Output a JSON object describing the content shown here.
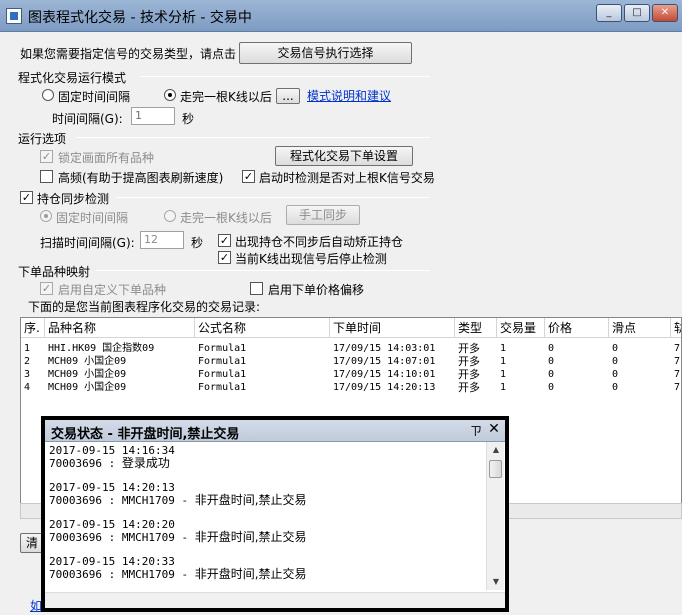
{
  "window": {
    "title": "图表程式化交易 - 技术分析 - 交易中",
    "minimize": "_",
    "maximize": "□",
    "close": "✕"
  },
  "signal": {
    "prompt": "如果您需要指定信号的交易类型，请点击",
    "button": "交易信号执行选择"
  },
  "run_mode": {
    "section": "程式化交易运行模式",
    "fixed_interval": "固定时间间隔",
    "after_kline": "走完一根K线以后",
    "more_button": "...",
    "help_link": "模式说明和建议",
    "interval_label": "时间间隔(G):",
    "interval_value": "1",
    "interval_unit": "秒"
  },
  "run_options": {
    "section": "运行选项",
    "lock_all": "锁定画面所有品种",
    "order_settings": "程式化交易下单设置",
    "high_freq": "高频(有助于提高图表刷新速度)",
    "startup_check": "启动时检测是否对上根K信号交易"
  },
  "sync": {
    "section": "持仓同步检测",
    "fixed_interval": "固定时间间隔",
    "after_kline": "走完一根K线以后",
    "manual_sync": "手工同步",
    "scan_label": "扫描时间间隔(G):",
    "scan_value": "12",
    "scan_unit": "秒",
    "auto_correct": "出现持仓不同步后自动矫正持仓",
    "stop_detect": "当前K线出现信号后停止检测"
  },
  "mapping": {
    "section": "下单品种映射",
    "custom_enable": "启用自定义下单品种",
    "price_offset": "启用下单价格偏移"
  },
  "records": {
    "caption": "下面的是您当前图表程序化交易的交易记录:",
    "columns": [
      "序.",
      "品种名称",
      "公式名称",
      "下单时间",
      "类型",
      "交易量",
      "价格",
      "滑点",
      "轨"
    ],
    "rows": [
      [
        "1",
        "HHI.HK09 国企指数09",
        "Formula1",
        "17/09/15 14:03:01",
        "开多",
        "1",
        "0",
        "0",
        "7"
      ],
      [
        "2",
        "MCH09 小国企09",
        "Formula1",
        "17/09/15 14:07:01",
        "开多",
        "1",
        "0",
        "0",
        "7"
      ],
      [
        "3",
        "MCH09 小国企09",
        "Formula1",
        "17/09/15 14:10:01",
        "开多",
        "1",
        "0",
        "0",
        "7"
      ],
      [
        "4",
        "MCH09 小国企09",
        "Formula1",
        "17/09/15 14:20:13",
        "开多",
        "1",
        "0",
        "0",
        "7"
      ]
    ]
  },
  "bottom": {
    "clear_fragment": "清",
    "link_fragment": "如"
  },
  "popup": {
    "title": "交易状态 - 非开盘时间,禁止交易",
    "pin": "ㄗ",
    "close": "✕",
    "entries": [
      {
        "ts": "2017-09-15 14:16:34",
        "account": "70003696 : ",
        "msg": "登录成功"
      },
      {
        "ts": "2017-09-15 14:20:13",
        "account": "70003696 : MMCH1709 - ",
        "msg": "非开盘时间,禁止交易"
      },
      {
        "ts": "2017-09-15 14:20:20",
        "account": "70003696 : MMCH1709 - ",
        "msg": "非开盘时间,禁止交易"
      },
      {
        "ts": "2017-09-15 14:20:33",
        "account": "70003696 : MMCH1709 - ",
        "msg": "非开盘时间,禁止交易"
      }
    ]
  }
}
